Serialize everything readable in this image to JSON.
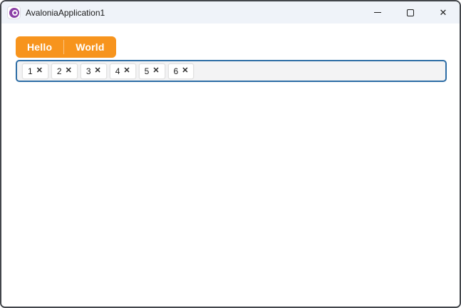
{
  "window": {
    "title": "AvaloniaApplication1",
    "close_glyph": "✕"
  },
  "tabs": [
    {
      "label": "Hello"
    },
    {
      "label": "World"
    }
  ],
  "chipbar": {
    "items": [
      {
        "label": "1"
      },
      {
        "label": "2"
      },
      {
        "label": "3"
      },
      {
        "label": "4"
      },
      {
        "label": "5"
      },
      {
        "label": "6"
      }
    ],
    "remove_glyph": "✕"
  },
  "colors": {
    "tab_accent": "#f7941d",
    "chipbar_border": "#2d6da5",
    "titlebar_bg": "#eff3f9",
    "window_border": "#43464b",
    "logo_purple": "#8b3fa6"
  }
}
